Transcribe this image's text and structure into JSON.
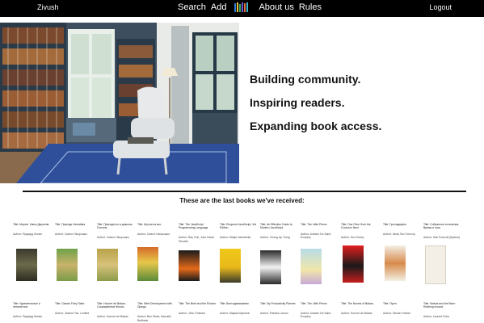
{
  "header": {
    "username": "Zivush",
    "nav": {
      "search": "Search",
      "add": "Add",
      "about": "About us",
      "rules": "Rules"
    },
    "logout": "Logout"
  },
  "hero": {
    "taglines": [
      "Building community.",
      "Inspiring readers.",
      "Expanding book access."
    ]
  },
  "recent": {
    "title": "These are the last books we've received:",
    "row1": [
      {
        "title": "Title: Мертві. Книга Джунглів",
        "author": "Author: Редьярд Кіплінг"
      },
      {
        "title": "Title: Пригоди Незнайка",
        "author": "Author: Смелл Нікорошко"
      },
      {
        "title": "Title: Пригодність в довкола Гатсона",
        "author": "Author: Смелл Нікорошко"
      },
      {
        "title": "Title: Шухля на вєс",
        "author": "Author: Смелл Нікорошко"
      },
      {
        "title": "Title: The JavaScript Programming Language",
        "author": "Author: Ray Toal, John David Dionisio"
      },
      {
        "title": "Title: Eloquent JavaScript, 3rd Edition",
        "author": "Author: Marijn Haverbeke"
      },
      {
        "title": "Title: An Effective Guide to Modern JavaScript",
        "author": "Author: Chong Up Trung"
      },
      {
        "title": "Title: The Little Prince",
        "author": "Author: Antoine De Saint-Exupéry"
      },
      {
        "title": "Title: One Flew Over the Cuckoo's Nest",
        "author": "Author: Ken Kesey"
      },
      {
        "title": "Title: Гра надмірне",
        "author": "Author: Шеф Лео Толстоу"
      },
      {
        "title": "Title: Собранное сочинения: Время и ночь",
        "author": "Author: Лев Толстой (Кратко)"
      }
    ],
    "row2": [
      {
        "title": "Title: Удивительные и непонятное",
        "author": "Author: Редьярд Кіплінг"
      },
      {
        "title": "Title: Classic Fairy Tales",
        "author": "Author: Jeanne Tan, Limited"
      },
      {
        "title": "Title: Honoré de Balzac - Сокращённые Жизнь",
        "author": "Author: Honoré de Balzac"
      },
      {
        "title": "Title: Web Development with Django",
        "author": "Author: Ben Shaw, Saurabh Badhwar"
      },
      {
        "title": "Title: The Brief and the Elusive",
        "author": "Author: John Grisham"
      },
      {
        "title": "Title: Вонтиданиманим",
        "author": "Author: Маркиз Щенков"
      },
      {
        "title": "Title: My Productivity Planner",
        "author": "Author: Patricia Larson"
      },
      {
        "title": "Title: The Little Prince",
        "author": "Author: Antoine De Saint-Exupéry"
      },
      {
        "title": "Title: The Novels of Balzac",
        "author": "Author: Honoré de Balzac"
      },
      {
        "title": "Title: Пусть",
        "author": "Author: Stevan Holmer"
      },
      {
        "title": "Title: Masha and the Bear: Rubbing Around",
        "author": "Author: Laurent Fulia"
      }
    ]
  }
}
